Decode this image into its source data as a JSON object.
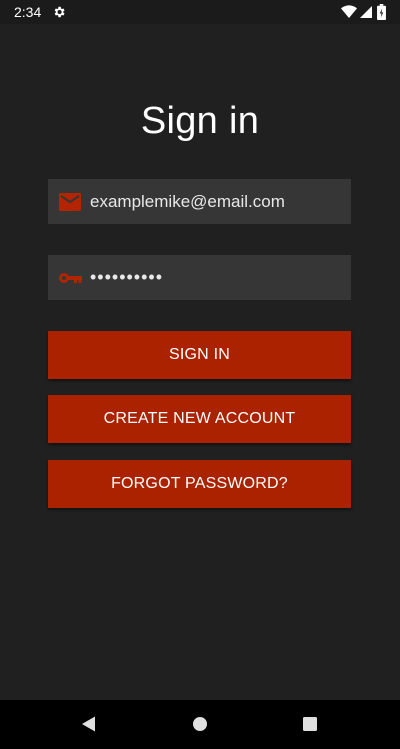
{
  "status_bar": {
    "time": "2:34",
    "icons": [
      "gear-icon",
      "wifi-icon",
      "signal-icon",
      "battery-icon"
    ]
  },
  "title": "Sign in",
  "email_field": {
    "value": "examplemike@email.com",
    "icon": "email-icon"
  },
  "password_field": {
    "value": "••••••••••",
    "icon": "key-icon"
  },
  "buttons": {
    "sign_in": "SIGN IN",
    "create_account": "CREATE NEW ACCOUNT",
    "forgot_password": "FORGOT PASSWORD?"
  },
  "nav_bar": {
    "icons": [
      "back-icon",
      "home-icon",
      "recents-icon"
    ]
  },
  "colors": {
    "background": "#202020",
    "field_background": "#363636",
    "accent": "#aa2200",
    "icon_accent": "#b32400"
  }
}
